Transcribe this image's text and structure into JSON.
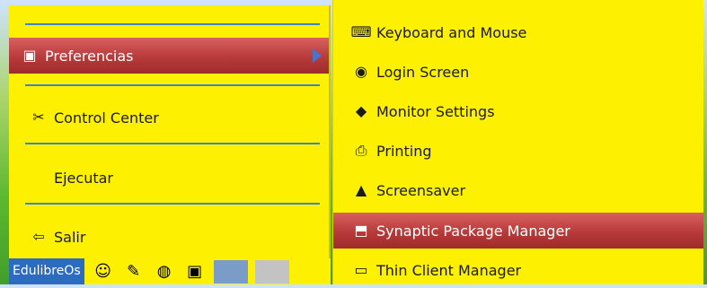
{
  "left_menu": {
    "items": [
      {
        "label": "Preferencias",
        "icon": "preferences-icon",
        "selected": true,
        "has_submenu": true
      },
      {
        "label": "Control Center",
        "icon": "control-center-icon"
      },
      {
        "label": "Ejecutar"
      },
      {
        "label": "Salir",
        "icon": "logout-icon"
      }
    ]
  },
  "submenu": {
    "items": [
      {
        "label": "Keyboard and Mouse",
        "icon": "keyboard-icon"
      },
      {
        "label": "Login Screen",
        "icon": "login-screen-icon"
      },
      {
        "label": "Monitor Settings",
        "icon": "monitor-settings-icon"
      },
      {
        "label": "Printing",
        "icon": "printer-icon"
      },
      {
        "label": "Screensaver",
        "icon": "screensaver-icon"
      },
      {
        "label": "Synaptic Package Manager",
        "icon": "package-manager-icon",
        "selected": true
      },
      {
        "label": "Thin Client Manager",
        "icon": "thin-client-icon"
      }
    ]
  },
  "taskbar": {
    "start_label": "EdulibreOs",
    "icons": [
      "people-icon",
      "pencil-icon",
      "globe-icon",
      "windows-icon"
    ]
  },
  "colors": {
    "menu_bg": "#fdf000",
    "selection": "#b83a3a",
    "separator": "#3b86c7",
    "submenu_arrow": "#4a73c9",
    "start_button": "#2b6cc0"
  }
}
